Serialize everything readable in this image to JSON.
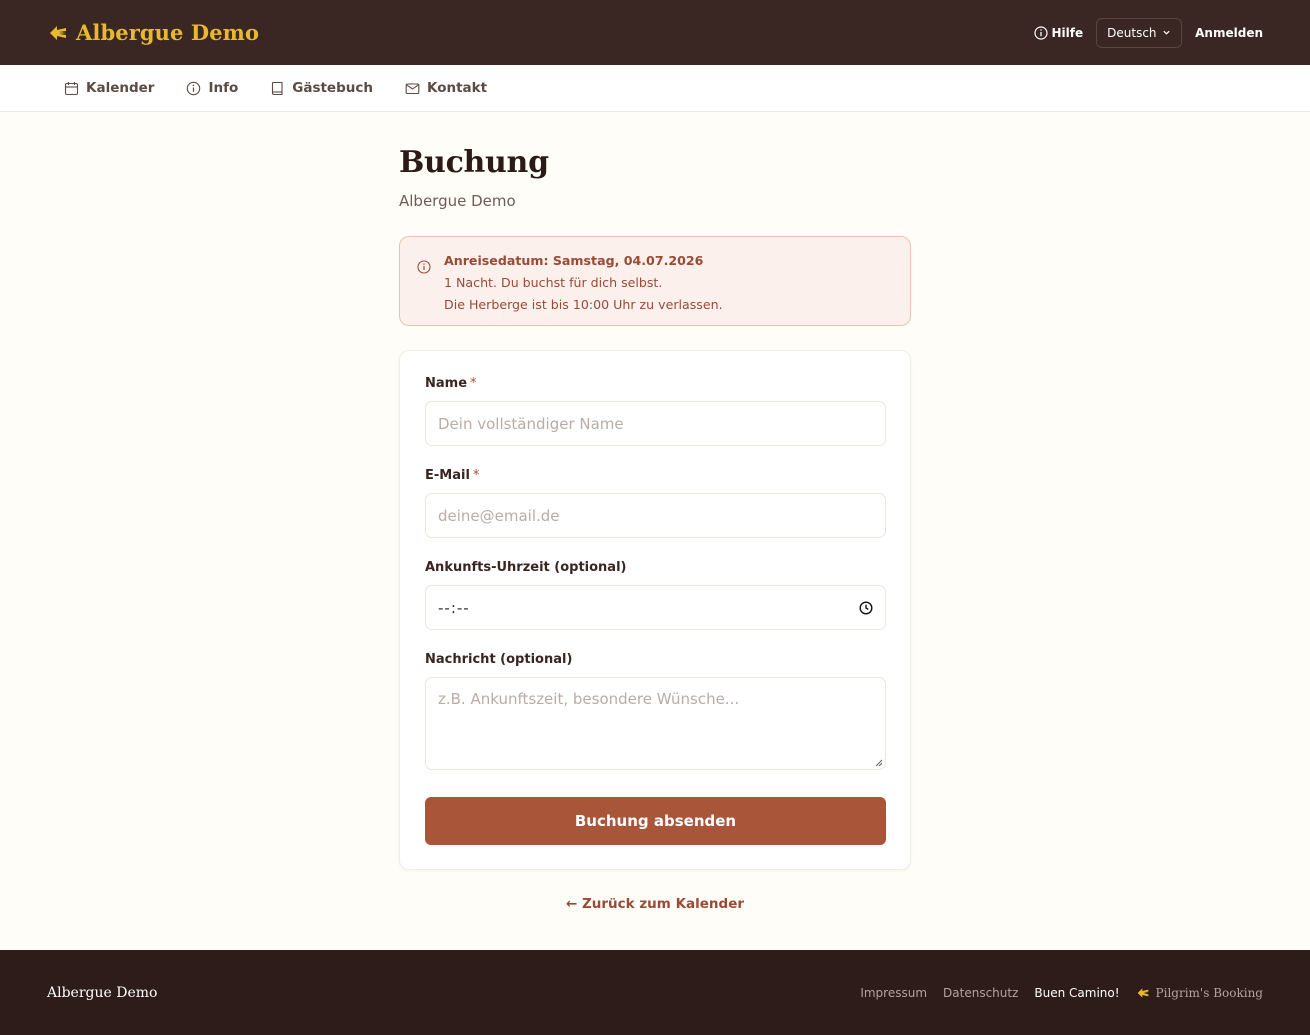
{
  "header": {
    "brand": "Albergue Demo",
    "help_label": "Hilfe",
    "language": "Deutsch",
    "login_label": "Anmelden"
  },
  "nav": {
    "items": [
      {
        "label": "Kalender",
        "icon": "calendar-icon"
      },
      {
        "label": "Info",
        "icon": "info-icon"
      },
      {
        "label": "Gästebuch",
        "icon": "book-icon"
      },
      {
        "label": "Kontakt",
        "icon": "mail-icon"
      }
    ]
  },
  "page": {
    "title": "Buchung",
    "subtitle": "Albergue Demo"
  },
  "alert": {
    "line1": "Anreisedatum: Samstag, 04.07.2026",
    "line2": "1 Nacht. Du buchst für dich selbst.",
    "line3": "Die Herberge ist bis 10:00 Uhr zu verlassen."
  },
  "form": {
    "name_label": "Name",
    "name_placeholder": "Dein vollständiger Name",
    "email_label": "E-Mail",
    "email_placeholder": "deine@email.de",
    "required_marker": "*",
    "time_label": "Ankunfts-Uhrzeit (optional)",
    "time_value": "--:--",
    "message_label": "Nachricht (optional)",
    "message_placeholder": "z.B. Ankunftszeit, besondere Wünsche...",
    "submit_label": "Buchung absenden"
  },
  "back_link": "← Zurück zum Kalender",
  "footer": {
    "name": "Albergue Demo",
    "links": [
      "Impressum",
      "Datenschutz"
    ],
    "camino": "Buen Camino!",
    "brand": "Pilgrim's Booking"
  },
  "colors": {
    "header_bg": "#3a2622",
    "brand_gold": "#e8b92e",
    "accent": "#a8553a",
    "footer_bg": "#2d1c19"
  }
}
